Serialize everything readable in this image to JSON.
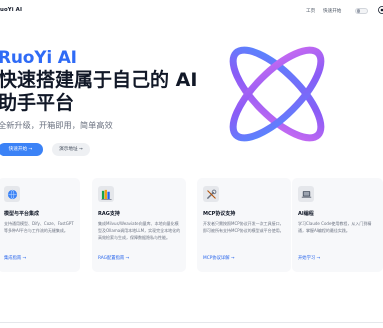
{
  "header": {
    "brand": "uoYi AI",
    "nav": {
      "home": "工页",
      "quick_start": "快速开始"
    }
  },
  "hero": {
    "name": "RuoYi AI",
    "title_line1": "快速搭建属于自己的 AI",
    "title_line2": "助手平台",
    "subtitle": "全新升级，开箱即用，简单高效",
    "primary_button": "快速开始 →",
    "secondary_button": "演示地址 →"
  },
  "features": [
    {
      "icon": "globe-icon",
      "title": "模型与平台集成",
      "desc": "支持通用模型、Dify、Coze、FastGPT等多种AI平台与工作流的无缝集成。",
      "link": "集成指南 →"
    },
    {
      "icon": "book-stack-icon",
      "title": "RAG支持",
      "desc": "集成Milvus/Weaviate向量库、本地向量化模型及Ollama调用本地LLM，实现完全本地化的高效检索与生成，保障数据隐私与性能。",
      "link": "RAG配置指南 →"
    },
    {
      "icon": "tools-icon",
      "title": "MCP协议支持",
      "desc": "开发者只需按照MCP协议开发一次工具接口，即可被所有支持MCP协议的模型或平台使用。",
      "link": "MCP协议详解 →"
    },
    {
      "icon": "laptop-icon",
      "title": "AI编程",
      "desc": "学习Claude Code使用教程，从入门到精通，掌握AI编程的最佳实践。",
      "link": "开始学习 →"
    }
  ]
}
